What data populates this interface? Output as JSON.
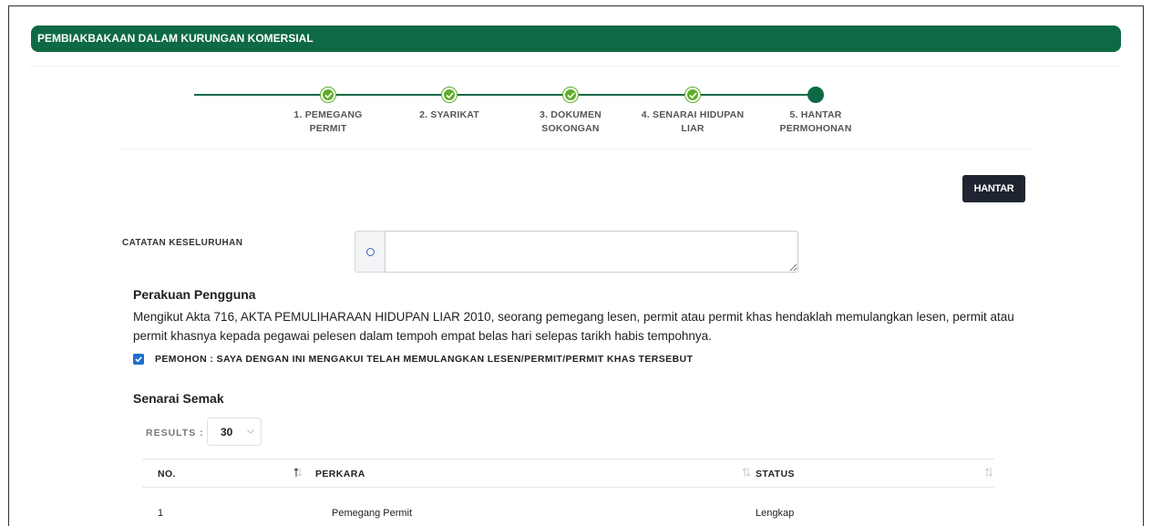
{
  "header": {
    "title": "PEMBIAKBAKAAN DALAM KURUNGAN KOMERSIAL"
  },
  "stepper": {
    "steps": [
      {
        "line1": "1. PEMEGANG",
        "line2": "PERMIT",
        "status": "complete"
      },
      {
        "line1": "2. SYARIKAT",
        "line2": "",
        "status": "complete"
      },
      {
        "line1": "3. DOKUMEN",
        "line2": "SOKONGAN",
        "status": "complete"
      },
      {
        "line1": "4. SENARAI HIDUPAN",
        "line2": "LIAR",
        "status": "complete"
      },
      {
        "line1": "5. HANTAR",
        "line2": "PERMOHONAN",
        "status": "active"
      }
    ]
  },
  "actions": {
    "hantar_label": "HANTAR"
  },
  "catatan": {
    "label": "CATATAN KESELURUHAN",
    "value": "",
    "icon": "info-icon"
  },
  "perakuan": {
    "title": "Perakuan Pengguna",
    "text": "Mengikut Akta 716, AKTA PEMULIHARAAN HIDUPAN LIAR 2010, seorang pemegang lesen, permit atau permit khas hendaklah memulangkan lesen, permit atau permit khasnya kepada pegawai pelesen dalam tempoh empat belas hari selepas tarikh habis tempohnya.",
    "checkbox_label": "PEMOHON : SAYA DENGAN INI MENGAKUI TELAH MEMULANGKAN LESEN/PERMIT/PERMIT KHAS TERSEBUT",
    "checked": true
  },
  "senarai": {
    "title": "Senarai Semak",
    "results_label": "RESULTS :",
    "results_value": "30",
    "columns": [
      "NO.",
      "PERKARA",
      "STATUS"
    ],
    "rows": [
      {
        "no": "1",
        "perkara": "Pemegang Permit",
        "status": "Lengkap"
      }
    ]
  },
  "colors": {
    "brand_green": "#0e6a45",
    "step_complete": "#61ad2b",
    "button_dark": "#1f2530",
    "checkbox_blue": "#1f6fd1"
  }
}
